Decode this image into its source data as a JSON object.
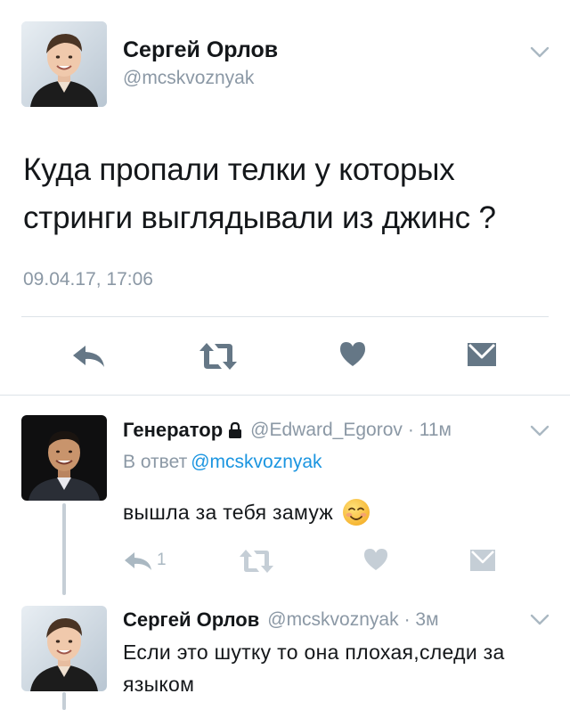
{
  "main_tweet": {
    "name": "Сергей Орлов",
    "handle": "@mcskvoznyak",
    "text": "Куда пропали телки у которых стринги выглядывали из джинс ?",
    "timestamp": "09.04.17, 17:06",
    "icons": {
      "avatar": "profile-photo",
      "menu": "chevron-down-icon",
      "reply": "reply-icon",
      "retweet": "retweet-icon",
      "like": "heart-icon",
      "dm": "envelope-icon"
    }
  },
  "replies": [
    {
      "name": "Генератор",
      "protected_icon": "lock-icon",
      "handle": "@Edward_Egorov",
      "time": "· 11м",
      "in_reply_to_label": "В ответ",
      "in_reply_to_handle": "@mcskvoznyak",
      "text": "вышла за тебя замуж",
      "emoji": "smiling-face-emoji",
      "reply_count": "1"
    },
    {
      "name": "Сергей Орлов",
      "handle": "@mcskvoznyak",
      "time": "· 3м",
      "text": "Если это шутку то она плохая,следи за языком"
    }
  ],
  "colors": {
    "text": "#14171a",
    "secondary": "#8b98a5",
    "link": "#1b95e0",
    "action_main": "#657786",
    "action_reply": "#aab8c2",
    "divider": "#dde3e8"
  }
}
